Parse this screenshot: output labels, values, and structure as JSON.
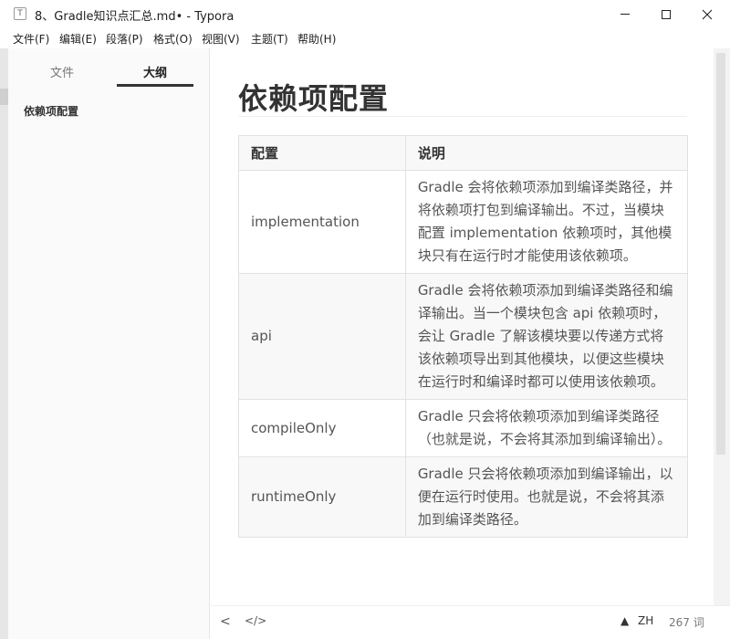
{
  "window": {
    "app_icon": "T",
    "title": "8、Gradle知识点汇总.md• - Typora",
    "controls": [
      "minimize-icon",
      "maximize-icon",
      "close-icon"
    ]
  },
  "menu": [
    {
      "label": "文件(F)"
    },
    {
      "label": "编辑(E)"
    },
    {
      "label": "段落(P)"
    },
    {
      "label": "格式(O)"
    },
    {
      "label": "视图(V)"
    },
    {
      "label": "主题(T)"
    },
    {
      "label": "帮助(H)"
    }
  ],
  "sidebar": {
    "tabs": [
      {
        "label": "文件",
        "active": false
      },
      {
        "label": "大纲",
        "active": true
      }
    ],
    "outline": [
      {
        "label": "依赖项配置"
      }
    ]
  },
  "document": {
    "heading": "依赖项配置",
    "table": {
      "headers": [
        "配置",
        "说明"
      ],
      "rows": [
        {
          "config": "implementation",
          "desc": "Gradle 会将依赖项添加到编译类路径，并将依赖项打包到编译输出。不过，当模块配置 implementation 依赖项时，其他模块只有在运行时才能使用该依赖项。"
        },
        {
          "config": "api",
          "desc": "Gradle 会将依赖项添加到编译类路径和编译输出。当一个模块包含 api 依赖项时，会让 Gradle 了解该模块要以传递方式将该依赖项导出到其他模块，以便这些模块在运行时和编译时都可以使用该依赖项。"
        },
        {
          "config": "compileOnly",
          "desc": "Gradle 只会将依赖项添加到编译类路径（也就是说，不会将其添加到编译输出）。"
        },
        {
          "config": "runtimeOnly",
          "desc": "Gradle 只会将依赖项添加到编译输出，以便在运行时使用。也就是说，不会将其添加到编译类路径。"
        }
      ]
    }
  },
  "statusbar": {
    "back_icon": "<",
    "source_icon": "</>",
    "warning_icon": "▲",
    "language": "ZH",
    "word_count": "267 词"
  }
}
